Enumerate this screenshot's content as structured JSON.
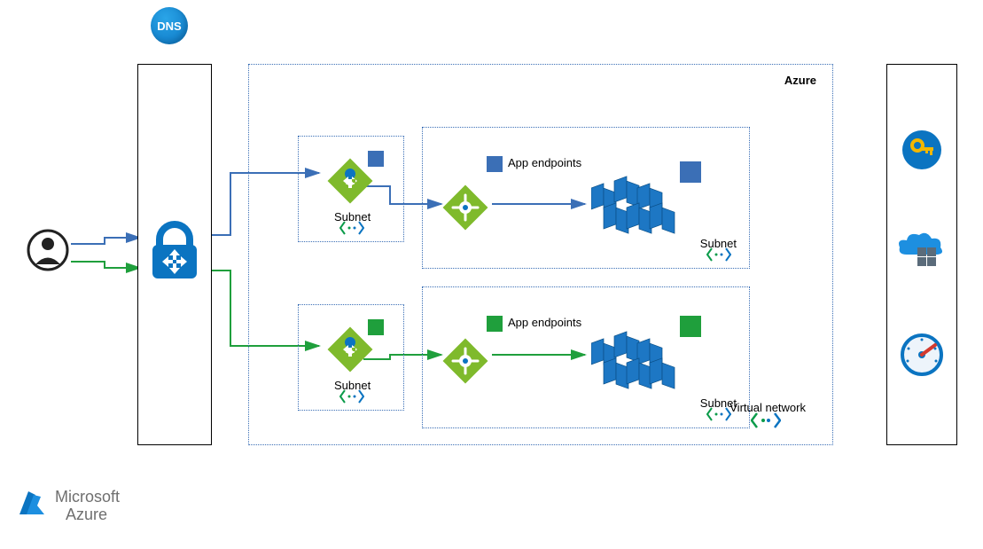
{
  "title": "Azure",
  "dns_label": "DNS",
  "subnet_label": "Subnet",
  "vnet_label": "Virtual network",
  "app_endpoints_label": "App endpoints",
  "brand_line1": "Microsoft",
  "brand_line2": "Azure",
  "colors": {
    "blue_path": "#3b6fb6",
    "green_path": "#1f9f3c",
    "azure_blue": "#0b74c1",
    "diamond_green": "#7fba2c",
    "cluster_blue": "#1d77c4"
  },
  "icons": {
    "user": "user-icon",
    "dns": "dns-icon",
    "firewall_lock": "firewall-lock-icon",
    "app_gateway": "app-gateway-icon",
    "load_balancer": "load-balancer-icon",
    "vm_cluster": "vm-cluster-icon",
    "vnet": "vnet-icon",
    "key_vault": "key-vault-icon",
    "container_registry": "container-registry-icon",
    "monitor_gauge": "monitor-gauge-icon",
    "azure_logo": "azure-logo-icon"
  },
  "entities": {
    "firewall": "Azure Firewall / WAF",
    "path_blue": "Blue deployment path",
    "path_green": "Green deployment path"
  }
}
